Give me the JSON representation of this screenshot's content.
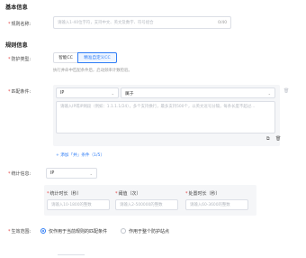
{
  "basic": {
    "title": "基本信息",
    "rule_name_label": "规则名称:",
    "rule_name_placeholder": "请输入1-40位字符，支持中文、英文及数字、符号组合",
    "rule_name_counter": "0/40"
  },
  "protection": {
    "title": "规则信息",
    "type_label": "防护类型:",
    "type_options": [
      "智能CC",
      "精准自定义CC"
    ],
    "type_selected": "精准自定义CC",
    "type_hint": "执行并命中匹配条件后，启动频率计数检验。",
    "match_label": "匹配条件:",
    "match_field": "IP",
    "match_operator": "属于",
    "match_value_placeholder": "请输入IP或IP网段（例如：1.1.1.1/24），多个支持换行，最多支持500个，以英文逗号分隔，每条长度不超过...",
    "add_condition_link": "+ 添加「并」条件（1/5）",
    "stat_label": "统计信息:",
    "stat_field": "IP",
    "stat_fields": [
      {
        "label": "统计时长（秒）",
        "placeholder": "请输入10-1800的整数"
      },
      {
        "label": "阈值（次）",
        "placeholder": "请输入2-500000的整数"
      },
      {
        "label": "处置时长（秒）",
        "placeholder": "请输入60-3600的整数"
      }
    ],
    "scope_label": "生效范围:",
    "scope_options": [
      "仅作用于当前规则的匹配条件",
      "作用于整个防护站点"
    ],
    "scope_selected": "仅作用于当前规则的匹配条件"
  }
}
